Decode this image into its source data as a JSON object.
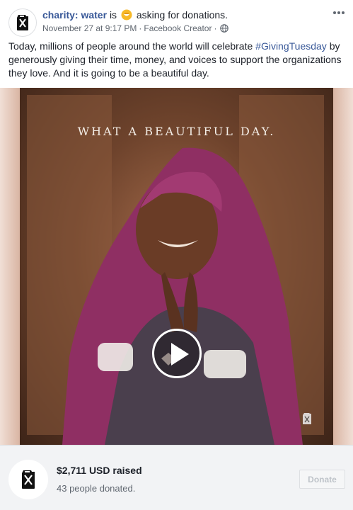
{
  "header": {
    "page_name": "charity: water",
    "is_text": "is",
    "activity": "asking for donations.",
    "timestamp": "November 27 at 9:17 PM",
    "separator": "·",
    "source": "Facebook Creator",
    "privacy_icon": "globe-icon",
    "more_icon": "more-options-icon"
  },
  "post": {
    "text_before": "Today, millions of people around the world will celebrate ",
    "hashtag": "#GivingTuesday",
    "text_after": " by generously giving their time, money, and voices to support the organizations they love. And it is going to be a beautiful day."
  },
  "video": {
    "overlay_title": "WHAT A BEAUTIFUL DAY.",
    "play_icon": "play-icon",
    "watermark_icon": "jerry-can-icon"
  },
  "fundraiser": {
    "amount": "$2,711 USD raised",
    "donors": "43 people donated.",
    "donate_label": "Donate"
  },
  "colors": {
    "link": "#385898",
    "text": "#1d2129",
    "secondary": "#606770",
    "fundraiser_bg": "#f2f3f5"
  }
}
